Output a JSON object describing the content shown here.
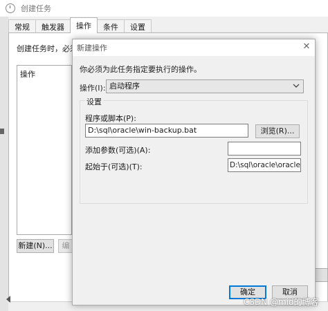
{
  "window": {
    "title": "创建任务"
  },
  "tabs": [
    {
      "label": "常规"
    },
    {
      "label": "触发器"
    },
    {
      "label": "操作"
    },
    {
      "label": "条件"
    },
    {
      "label": "设置"
    }
  ],
  "main": {
    "intro_text": "创建任务时，必须",
    "list_header": "操作",
    "new_button": "新建(N)...",
    "edit_button": "编"
  },
  "dialog": {
    "title": "新建操作",
    "must_text": "你必须为此任务指定要执行的操作。",
    "action_label": "操作(I):",
    "action_value": "启动程序",
    "settings_group": "设置",
    "program_label": "程序或脚本(P):",
    "program_value": "D:\\sql\\oracle\\win-backup.bat",
    "browse_button": "浏览(R)...",
    "args_label": "添加参数(可选)(A):",
    "args_value": "",
    "start_label": "起始于(可选)(T):",
    "start_value": "D:\\sql\\oracle\\oracle文",
    "ok_button": "确定",
    "cancel_button": "取消"
  },
  "watermark": "CSDN @mid的博客",
  "colors": {
    "accent": "#0078d7",
    "window_bg": "#f0f0f0"
  }
}
